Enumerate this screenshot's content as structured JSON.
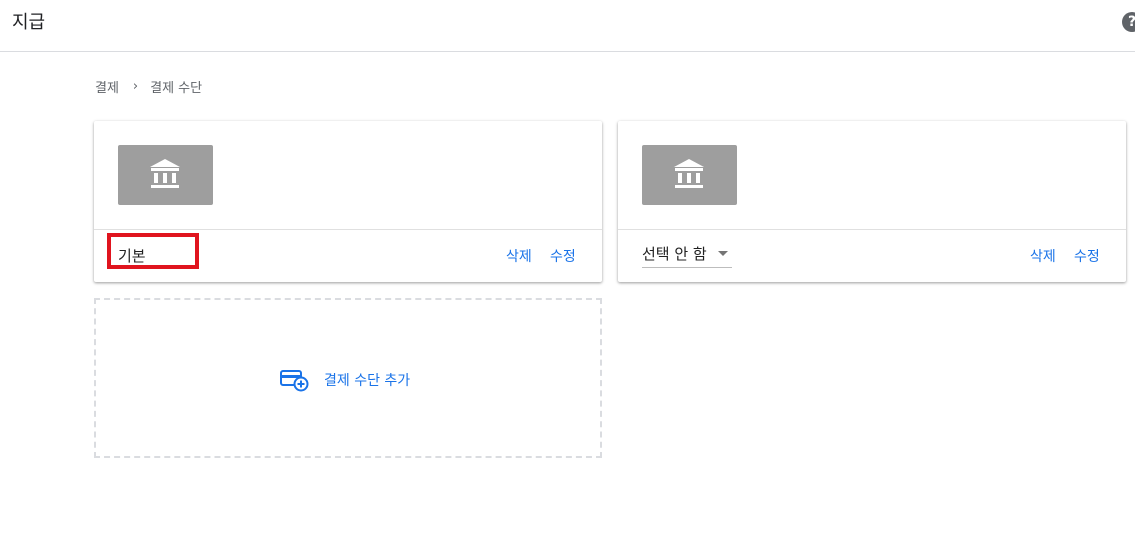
{
  "header": {
    "title": "지급",
    "help_glyph": "?"
  },
  "breadcrumb": {
    "items": [
      "결제",
      "결제 수단"
    ],
    "separator": "›"
  },
  "cards": [
    {
      "icon": "bank-icon",
      "name": "기본",
      "highlighted": true,
      "delete_label": "삭제",
      "edit_label": "수정"
    },
    {
      "icon": "bank-icon",
      "select_value": "선택 안 함",
      "delete_label": "삭제",
      "edit_label": "수정"
    }
  ],
  "add_method": {
    "icon": "add-card-icon",
    "label": "결제 수단 추가"
  },
  "colors": {
    "link": "#1a73e8",
    "thumb_bg": "#9e9e9e",
    "highlight": "#e0141e"
  }
}
